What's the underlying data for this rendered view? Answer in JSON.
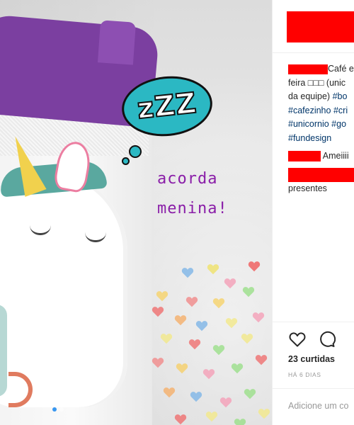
{
  "post": {
    "image_overlay": {
      "bubble_text": "zZZ",
      "caption_line1": "acorda",
      "caption_line2": "menina!"
    },
    "carousel": {
      "total": 2,
      "active": 1
    }
  },
  "caption": {
    "line1_text": "Café e",
    "line2_text": "feira □□□ (unic",
    "line3_text": "da equipe) ",
    "line3_tag": "#bo",
    "line4_tag1": "#cafezinho",
    "line4_tag2": "#cri",
    "line5_tag1": "#unicornio",
    "line5_tag2": "#go",
    "line6_tag": "#fundesign"
  },
  "comments": [
    {
      "text": "Ameiiii"
    },
    {
      "text": "presentes"
    }
  ],
  "actions": {
    "like_icon": "heart-icon",
    "comment_icon": "comment-icon",
    "likes_text": "23 curtidas",
    "timestamp": "HÁ 6 DIAS"
  },
  "comment_box": {
    "placeholder": "Adicione um co"
  },
  "colors": {
    "redaction": "#ff0000",
    "hashtag": "#003569",
    "bubble": "#2bb8c3",
    "caption_overlay": "#8a1ea8",
    "lid": "#7b3fa0"
  }
}
